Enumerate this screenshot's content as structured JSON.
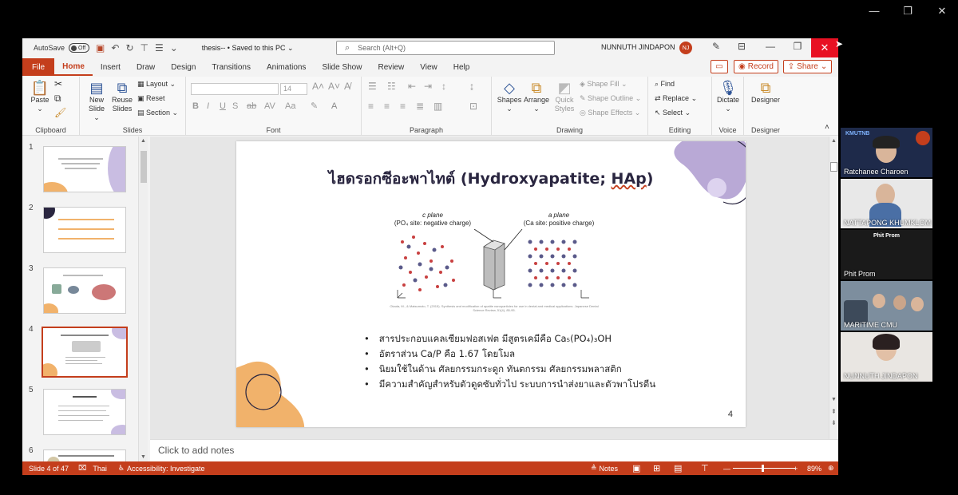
{
  "window": {
    "minimize": "—",
    "restore": "❐",
    "close": "✕"
  },
  "titlebar": {
    "autosave_label": "AutoSave",
    "autosave_state": "Off",
    "doc_title": "thesis-- • Saved to this PC ⌄",
    "search_placeholder": "Search (Alt+Q)",
    "user_name": "NUNNUTH JINDAPON",
    "user_initials": "NJ"
  },
  "tabs": [
    "File",
    "Home",
    "Insert",
    "Draw",
    "Design",
    "Transitions",
    "Animations",
    "Slide Show",
    "Review",
    "View",
    "Help"
  ],
  "tab_actions": {
    "record": "Record",
    "share": "Share"
  },
  "ribbon": {
    "clipboard": {
      "label": "Clipboard",
      "paste": "Paste"
    },
    "slides": {
      "label": "Slides",
      "new_slide": "New Slide",
      "reuse_slides": "Reuse Slides",
      "layout": "Layout",
      "reset": "Reset",
      "section": "Section"
    },
    "font": {
      "label": "Font",
      "size": "14"
    },
    "paragraph": {
      "label": "Paragraph"
    },
    "drawing": {
      "label": "Drawing",
      "shapes": "Shapes",
      "arrange": "Arrange",
      "quick_styles": "Quick Styles",
      "shape_fill": "Shape Fill",
      "shape_outline": "Shape Outline",
      "shape_effects": "Shape Effects"
    },
    "editing": {
      "label": "Editing",
      "find": "Find",
      "replace": "Replace",
      "select": "Select"
    },
    "voice": {
      "label": "Voice",
      "dictate": "Dictate"
    },
    "designer": {
      "label": "Designer",
      "designer": "Designer"
    }
  },
  "thumbnails": [
    {
      "number": "1"
    },
    {
      "number": "2"
    },
    {
      "number": "3"
    },
    {
      "number": "4"
    },
    {
      "number": "5"
    },
    {
      "number": "6"
    }
  ],
  "slide": {
    "title_main": "ไฮดรอกซีอะพาไทต์ (Hydroxyapatite; ",
    "title_hap": "HAp",
    "title_end": ")",
    "c_plane_label": "c plane",
    "c_plane_sub": "(PO₄ site: negative charge)",
    "a_plane_label": "a plane",
    "a_plane_sub": "(Ca site: positive charge)",
    "citation": "Okada, M., & Matsumoto, T. (2015). Synthesis and modification of apatite nanoparticles for use in dental and medical applications. Japanese Dental Science Review, 51(4), 85-95.",
    "bullets": [
      "สารประกอบแคลเซียมฟอสเฟต มีสูตรเคมีคือ Ca₅(PO₄)₃OH",
      "อัตราส่วน Ca/P คือ 1.67 โดยโมล",
      "นิยมใช้ในด้าน ศัลยกรรมกระดูก ทันตกรรม ศัลยกรรมพลาสติก",
      "มีความสำคัญสำหรับตัวดูดซับทั่วไป ระบบการนำส่งยาและตัวพาโปรตีน"
    ],
    "number": "4"
  },
  "notes_placeholder": "Click to add notes",
  "statusbar": {
    "slide_info": "Slide 4 of 47",
    "language": "Thai",
    "accessibility": "Accessibility: Investigate",
    "notes": "Notes",
    "zoom": "89%"
  },
  "participants": [
    {
      "name": "Ratchanee Charoen",
      "top_label": "KMUTNB"
    },
    {
      "name": "NATTAPONG KHUMKLOM"
    },
    {
      "name": "Phit Prom",
      "top_label": "Phit Prom"
    },
    {
      "name": "MARITIME CMU"
    },
    {
      "name": "NUNNUTH JINDAPON"
    }
  ],
  "colors": {
    "accent": "#c43e1c",
    "slide_purple": "#b9a9d6",
    "slide_orange": "#f1b26b",
    "title_dark": "#2a2640"
  }
}
